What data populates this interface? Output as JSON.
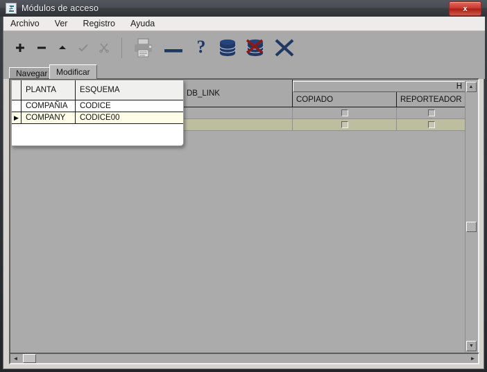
{
  "window": {
    "title": "Módulos de acceso",
    "icon": "app-window-icon",
    "close_label": "x"
  },
  "menubar": {
    "items": [
      {
        "label": "Archivo"
      },
      {
        "label": "Ver"
      },
      {
        "label": "Registro"
      },
      {
        "label": "Ayuda"
      }
    ]
  },
  "toolbar": {
    "buttons": [
      {
        "name": "insert-record-icon",
        "glyph": "✚",
        "enabled": true,
        "color": "#1c1c1c"
      },
      {
        "name": "delete-record-icon",
        "glyph": "━",
        "enabled": true,
        "color": "#1c1c1c"
      },
      {
        "name": "move-up-icon",
        "glyph": "▲",
        "enabled": true,
        "color": "#1c1c1c"
      },
      {
        "name": "confirm-check-icon",
        "glyph": "✓",
        "enabled": false,
        "color": "#6d6d6d"
      },
      {
        "name": "cut-scissors-icon",
        "glyph": "✂",
        "enabled": false,
        "color": "#6d6d6d"
      },
      {
        "name": "print-icon",
        "glyph": "🖶",
        "enabled": true,
        "color": "#8f8f8f"
      },
      {
        "name": "dash-icon",
        "glyph": "▬",
        "enabled": true,
        "color": "#1f3864"
      },
      {
        "name": "help-icon",
        "glyph": "?",
        "enabled": true,
        "color": "#1f3864"
      },
      {
        "name": "database-icon",
        "glyph": "db",
        "enabled": true,
        "color": "#1f3864"
      },
      {
        "name": "database-delete-icon",
        "glyph": "dbx",
        "enabled": true,
        "color": "#1f3864"
      },
      {
        "name": "close-x-icon",
        "glyph": "✕",
        "enabled": true,
        "color": "#1f3864"
      }
    ],
    "accent_navy": "#1f3864",
    "accent_red": "#8b1a16"
  },
  "tabs": [
    {
      "label": "Navegar",
      "active": false
    },
    {
      "label": "Modificar",
      "active": true
    }
  ],
  "grid": {
    "group_header": "H",
    "columns": [
      {
        "key": "planta",
        "label": "PLANTA"
      },
      {
        "key": "esquema",
        "label": "ESQUEMA"
      },
      {
        "key": "db_link",
        "label": "DB_LINK"
      },
      {
        "key": "copiado",
        "label": "COPIADO"
      },
      {
        "key": "reporteador",
        "label": "REPORTEADOR"
      }
    ],
    "rows": [
      {
        "indicator": "",
        "planta": "COMPAÑIA",
        "esquema": "CODICE",
        "db_link": "",
        "copiado": false,
        "reporteador": false,
        "selected": false
      },
      {
        "indicator": "▶",
        "planta": "COMPANY",
        "esquema": "CODICE00",
        "db_link": "",
        "copiado": false,
        "reporteador": false,
        "selected": true
      }
    ],
    "selected_row_color": "#bdbda0",
    "popup_selected_color": "#fdfde8"
  },
  "scrollbars": {
    "v_up": "▲",
    "v_down": "▼",
    "h_left": "◄",
    "h_right": "►"
  }
}
